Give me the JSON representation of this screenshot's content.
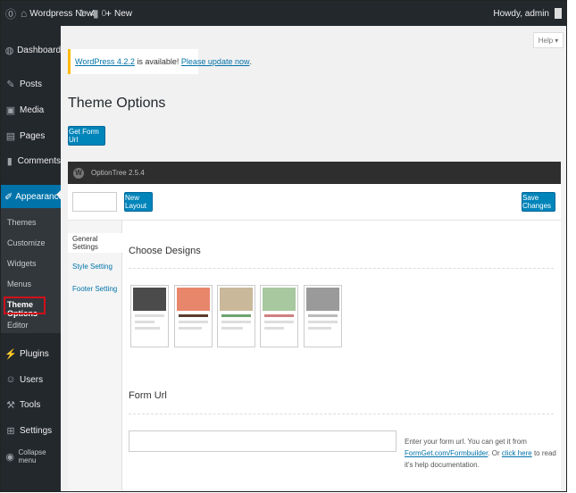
{
  "adminbar": {
    "wp_logo_icon": "wordpress-logo-icon",
    "site_name": "Wordpress New",
    "updates_count": "4",
    "comments_count": "0",
    "new_label": "New",
    "howdy": "Howdy, admin"
  },
  "sidebar": {
    "items": [
      {
        "label": "Dashboard",
        "icon": "dashboard-icon"
      },
      {
        "label": "Posts",
        "icon": "pin-icon"
      },
      {
        "label": "Media",
        "icon": "media-icon"
      },
      {
        "label": "Pages",
        "icon": "pages-icon"
      },
      {
        "label": "Comments",
        "icon": "comment-icon"
      },
      {
        "label": "Appearance",
        "icon": "brush-icon"
      },
      {
        "label": "Plugins",
        "icon": "plug-icon"
      },
      {
        "label": "Users",
        "icon": "users-icon"
      },
      {
        "label": "Tools",
        "icon": "wrench-icon"
      },
      {
        "label": "Settings",
        "icon": "settings-icon"
      },
      {
        "label": "Collapse menu",
        "icon": "collapse-icon"
      }
    ],
    "submenu": [
      "Themes",
      "Customize",
      "Widgets",
      "Menus",
      "Theme Options",
      "Editor"
    ]
  },
  "help_label": "Help",
  "notice": {
    "link1": "WordPress 4.2.2",
    "middle": " is available! ",
    "link2": "Please update now",
    "end": "."
  },
  "page_title": "Theme Options",
  "get_form_url": "Get Form Url",
  "optiontree": {
    "title": "OptionTree 2.5.4",
    "new_layout": "New Layout",
    "save_changes": "Save Changes",
    "tabs": [
      "General Settings",
      "Style Setting",
      "Footer Setting"
    ],
    "choose_designs": "Choose Designs",
    "form_url": "Form Url",
    "help_pre": "Enter your form url. You can get it from ",
    "help_link1": "FormGet.com/Formbuilder",
    "help_mid": ". Or ",
    "help_link2": "click here",
    "help_post": " to read it's help documentation."
  },
  "colors": {
    "adminbar_bg": "#23282d",
    "active_menu": "#0073aa",
    "button_blue": "#0085ba",
    "highlight_red": "#d0101a",
    "notice_border": "#ffba00"
  }
}
